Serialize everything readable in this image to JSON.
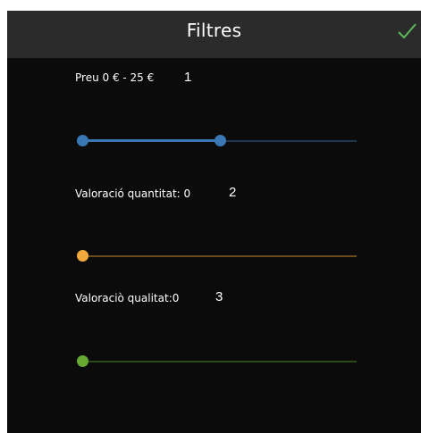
{
  "header": {
    "title": "Filtres",
    "confirm_icon": "checkmark-icon"
  },
  "colors": {
    "background": "#0b0b0b",
    "header": "#2b2b2b",
    "confirm": "#5cb85c",
    "price": "#3a78b5",
    "quantity": "#f0a93a",
    "quality": "#66a832"
  },
  "filters": [
    {
      "label": "Preu 0 € - 25 €",
      "annotation": "1",
      "range": [
        0,
        0.49
      ]
    },
    {
      "label": "Valoració quantitat: 0",
      "annotation": "2",
      "value": 0
    },
    {
      "label": "Valoraciò qualitat:0",
      "annotation": "3",
      "value": 0
    }
  ]
}
